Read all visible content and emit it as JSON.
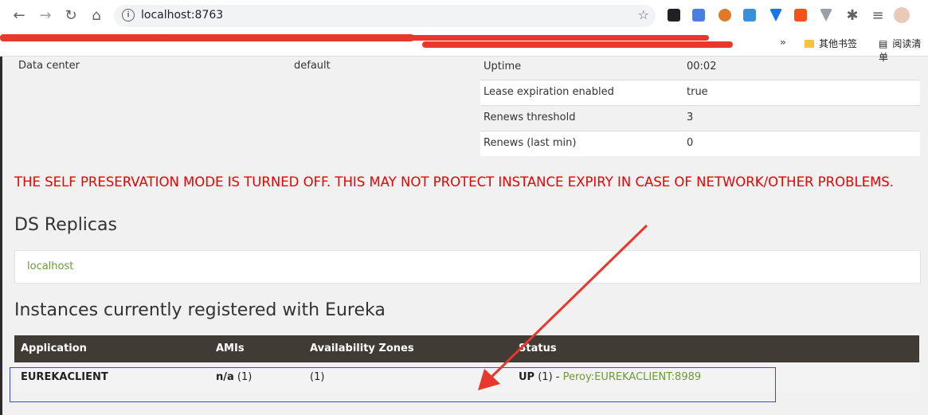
{
  "browser": {
    "url": "localhost:8763",
    "bookmarks": [
      "其他书签",
      "阅读清单"
    ],
    "bookmarks_more": "»"
  },
  "general_info": {
    "data_center_label": "Data center",
    "data_center_value": "default"
  },
  "stats": [
    {
      "key": "Uptime",
      "value": "00:02"
    },
    {
      "key": "Lease expiration enabled",
      "value": "true"
    },
    {
      "key": "Renews threshold",
      "value": "3"
    },
    {
      "key": "Renews (last min)",
      "value": "0"
    }
  ],
  "warning": "THE SELF PRESERVATION MODE IS TURNED OFF. THIS MAY NOT PROTECT INSTANCE EXPIRY IN CASE OF NETWORK/OTHER PROBLEMS.",
  "replicas": {
    "title": "DS Replicas",
    "items": [
      "localhost"
    ]
  },
  "instances": {
    "title": "Instances currently registered with Eureka",
    "columns": [
      "Application",
      "AMIs",
      "Availability Zones",
      "Status"
    ],
    "rows": [
      {
        "application": "EUREKACLIENT",
        "amis_bold": "n/a",
        "amis_count": "(1)",
        "zones": "(1)",
        "status_bold": "UP",
        "status_count": "(1) -",
        "status_link": "Peroy:EUREKACLIENT:8989"
      }
    ]
  },
  "colors": {
    "warning": "#ee0000",
    "link": "#6a9a3a",
    "table_header_bg": "#413b36",
    "annotation_arrow": "#e8372c",
    "highlight_box": "#3a4ec0"
  }
}
